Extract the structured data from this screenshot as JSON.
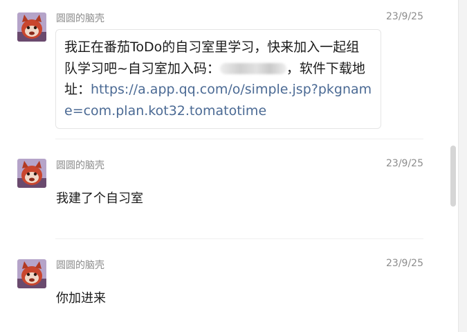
{
  "messages": [
    {
      "sender": "圆圆的脑壳",
      "time": "23/9/25",
      "text_before": "我正在番茄ToDo的自习室里学习，快来加入一起组队学习吧~自习室加入码：",
      "text_after": "，软件下载地址：",
      "link": "https://a.app.qq.com/o/simple.jsp?pkgname=com.plan.kot32.tomatotime"
    },
    {
      "sender": "圆圆的脑壳",
      "time": "23/9/25",
      "text": "我建了个自习室"
    },
    {
      "sender": "圆圆的脑壳",
      "time": "23/9/25",
      "text": "你加进来"
    }
  ],
  "icons": {
    "avatar": "avatar-red-panda-icon",
    "redacted": "blurred-code"
  },
  "colors": {
    "link": "#4b6a94",
    "meta_text": "#8c8c8c",
    "body_text": "#1a1a1a"
  }
}
